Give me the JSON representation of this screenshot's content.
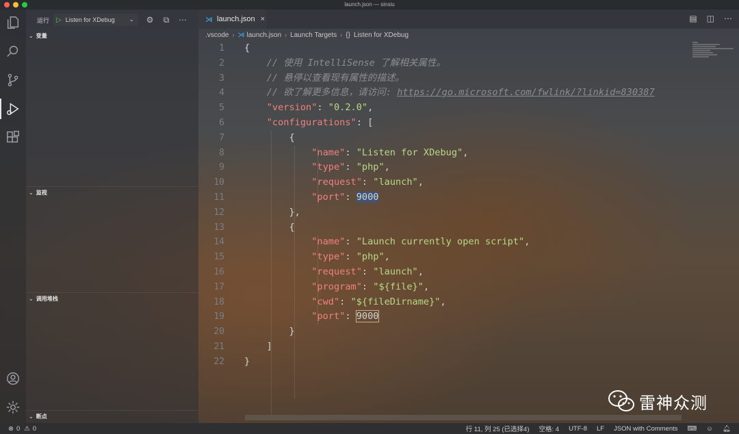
{
  "window": {
    "title": "launch.json — sinsiu"
  },
  "activity_bar": {
    "items": [
      "explorer-icon",
      "search-icon",
      "source-control-icon",
      "run-debug-icon",
      "extensions-icon"
    ],
    "bottom": [
      "account-icon",
      "manage-gear-icon"
    ]
  },
  "sidebar": {
    "run_label": "运行",
    "config_name": "Listen for XDebug",
    "sections": {
      "variables": "变量",
      "watch": "监视",
      "call_stack": "调用堆栈",
      "breakpoints": "断点"
    }
  },
  "tab": {
    "label": "launch.json"
  },
  "breadcrumb": {
    "folder": ".vscode",
    "file": "launch.json",
    "node1": "Launch Targets",
    "node2_icon": "{}",
    "node2": "Listen for XDebug"
  },
  "editor": {
    "line_numbers": [
      "1",
      "2",
      "3",
      "4",
      "5",
      "6",
      "7",
      "8",
      "9",
      "10",
      "11",
      "12",
      "13",
      "14",
      "15",
      "16",
      "17",
      "18",
      "19",
      "20",
      "21",
      "22"
    ],
    "lines": [
      "{",
      "    // 使用 IntelliSense 了解相关属性。",
      "    // 悬停以查看现有属性的描述。",
      "    // 欲了解更多信息，请访问: ",
      "https://go.microsoft.com/fwlink/?linkid=830387",
      "\"version\"",
      "\"0.2.0\"",
      "\"configurations\"",
      "\"name\"",
      "\"Listen for XDebug\"",
      "\"type\"",
      "\"php\"",
      "\"request\"",
      "\"launch\"",
      "\"port\"",
      "9000",
      "\"Launch currently open script\"",
      "\"program\"",
      "\"${file}\"",
      "\"cwd\"",
      "\"${fileDirname}\""
    ]
  },
  "status_bar": {
    "errors": "0",
    "warnings": "0",
    "position": "行 11, 列 25 (已选择4)",
    "spaces": "空格: 4",
    "encoding": "UTF-8",
    "eol": "LF",
    "language": "JSON with Comments"
  },
  "watermark": {
    "text": "雷神众测"
  },
  "colors": {
    "key": "#f0817e",
    "string": "#b8d987",
    "comment": "#8a8d93",
    "accent": "#3c99d4",
    "play": "#43c85a"
  }
}
